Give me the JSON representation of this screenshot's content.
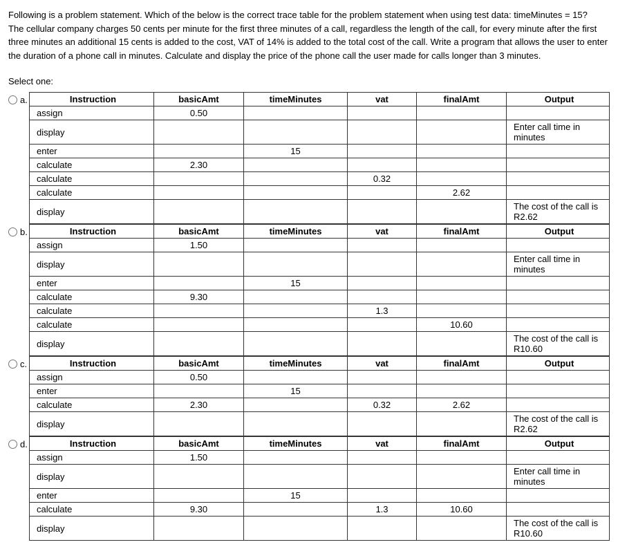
{
  "problem": {
    "line1": "Following is a problem statement. Which of the below is the correct trace table for the problem statement when using test data: timeMinutes = 15?",
    "line2": "The cellular company charges 50 cents per minute for the first three minutes of a call, regardless the length of the call, for every minute after the first three minutes an additional 15 cents is added to the cost, VAT of 14% is added to the total cost of the call. Write a program that allows the user to enter the duration of a phone call in minutes. Calculate and display the price of the phone call the user made for calls longer than 3 minutes."
  },
  "select_label": "Select one:",
  "headers": {
    "instruction": "Instruction",
    "basicAmt": "basicAmt",
    "timeMinutes": "timeMinutes",
    "vat": "vat",
    "finalAmt": "finalAmt",
    "output": "Output"
  },
  "options": [
    {
      "id": "a",
      "label": "a.",
      "rows": [
        {
          "instr": "assign",
          "basic": "0.50",
          "time": "",
          "vat": "",
          "final": "",
          "output": ""
        },
        {
          "instr": "display",
          "basic": "",
          "time": "",
          "vat": "",
          "final": "",
          "output": "Enter call time in minutes"
        },
        {
          "instr": "enter",
          "basic": "",
          "time": "15",
          "vat": "",
          "final": "",
          "output": ""
        },
        {
          "instr": "calculate",
          "basic": "2.30",
          "time": "",
          "vat": "",
          "final": "",
          "output": ""
        },
        {
          "instr": "calculate",
          "basic": "",
          "time": "",
          "vat": "0.32",
          "final": "",
          "output": ""
        },
        {
          "instr": "calculate",
          "basic": "",
          "time": "",
          "vat": "",
          "final": "2.62",
          "output": ""
        },
        {
          "instr": "display",
          "basic": "",
          "time": "",
          "vat": "",
          "final": "",
          "output": "The cost of the call is R2.62"
        }
      ]
    },
    {
      "id": "b",
      "label": "b.",
      "rows": [
        {
          "instr": "assign",
          "basic": "1.50",
          "time": "",
          "vat": "",
          "final": "",
          "output": ""
        },
        {
          "instr": "display",
          "basic": "",
          "time": "",
          "vat": "",
          "final": "",
          "output": "Enter call time in minutes"
        },
        {
          "instr": "enter",
          "basic": "",
          "time": "15",
          "vat": "",
          "final": "",
          "output": ""
        },
        {
          "instr": "calculate",
          "basic": "9.30",
          "time": "",
          "vat": "",
          "final": "",
          "output": ""
        },
        {
          "instr": "calculate",
          "basic": "",
          "time": "",
          "vat": "1.3",
          "final": "",
          "output": ""
        },
        {
          "instr": "calculate",
          "basic": "",
          "time": "",
          "vat": "",
          "final": "10.60",
          "output": ""
        },
        {
          "instr": "display",
          "basic": "",
          "time": "",
          "vat": "",
          "final": "",
          "output": "The cost of the call is R10.60"
        }
      ]
    },
    {
      "id": "c",
      "label": "c.",
      "rows": [
        {
          "instr": "assign",
          "basic": "0.50",
          "time": "",
          "vat": "",
          "final": "",
          "output": ""
        },
        {
          "instr": "enter",
          "basic": "",
          "time": "15",
          "vat": "",
          "final": "",
          "output": ""
        },
        {
          "instr": "calculate",
          "basic": "2.30",
          "time": "",
          "vat": "0.32",
          "final": "2.62",
          "output": ""
        },
        {
          "instr": "display",
          "basic": "",
          "time": "",
          "vat": "",
          "final": "",
          "output": "The cost of the call is R2.62"
        }
      ]
    },
    {
      "id": "d",
      "label": "d.",
      "rows": [
        {
          "instr": "assign",
          "basic": "1.50",
          "time": "",
          "vat": "",
          "final": "",
          "output": ""
        },
        {
          "instr": "display",
          "basic": "",
          "time": "",
          "vat": "",
          "final": "",
          "output": "Enter call time in minutes"
        },
        {
          "instr": "enter",
          "basic": "",
          "time": "15",
          "vat": "",
          "final": "",
          "output": ""
        },
        {
          "instr": "calculate",
          "basic": "9.30",
          "time": "",
          "vat": "1.3",
          "final": "10.60",
          "output": ""
        },
        {
          "instr": "display",
          "basic": "",
          "time": "",
          "vat": "",
          "final": "",
          "output": "The cost of the call is R10.60"
        }
      ]
    }
  ]
}
